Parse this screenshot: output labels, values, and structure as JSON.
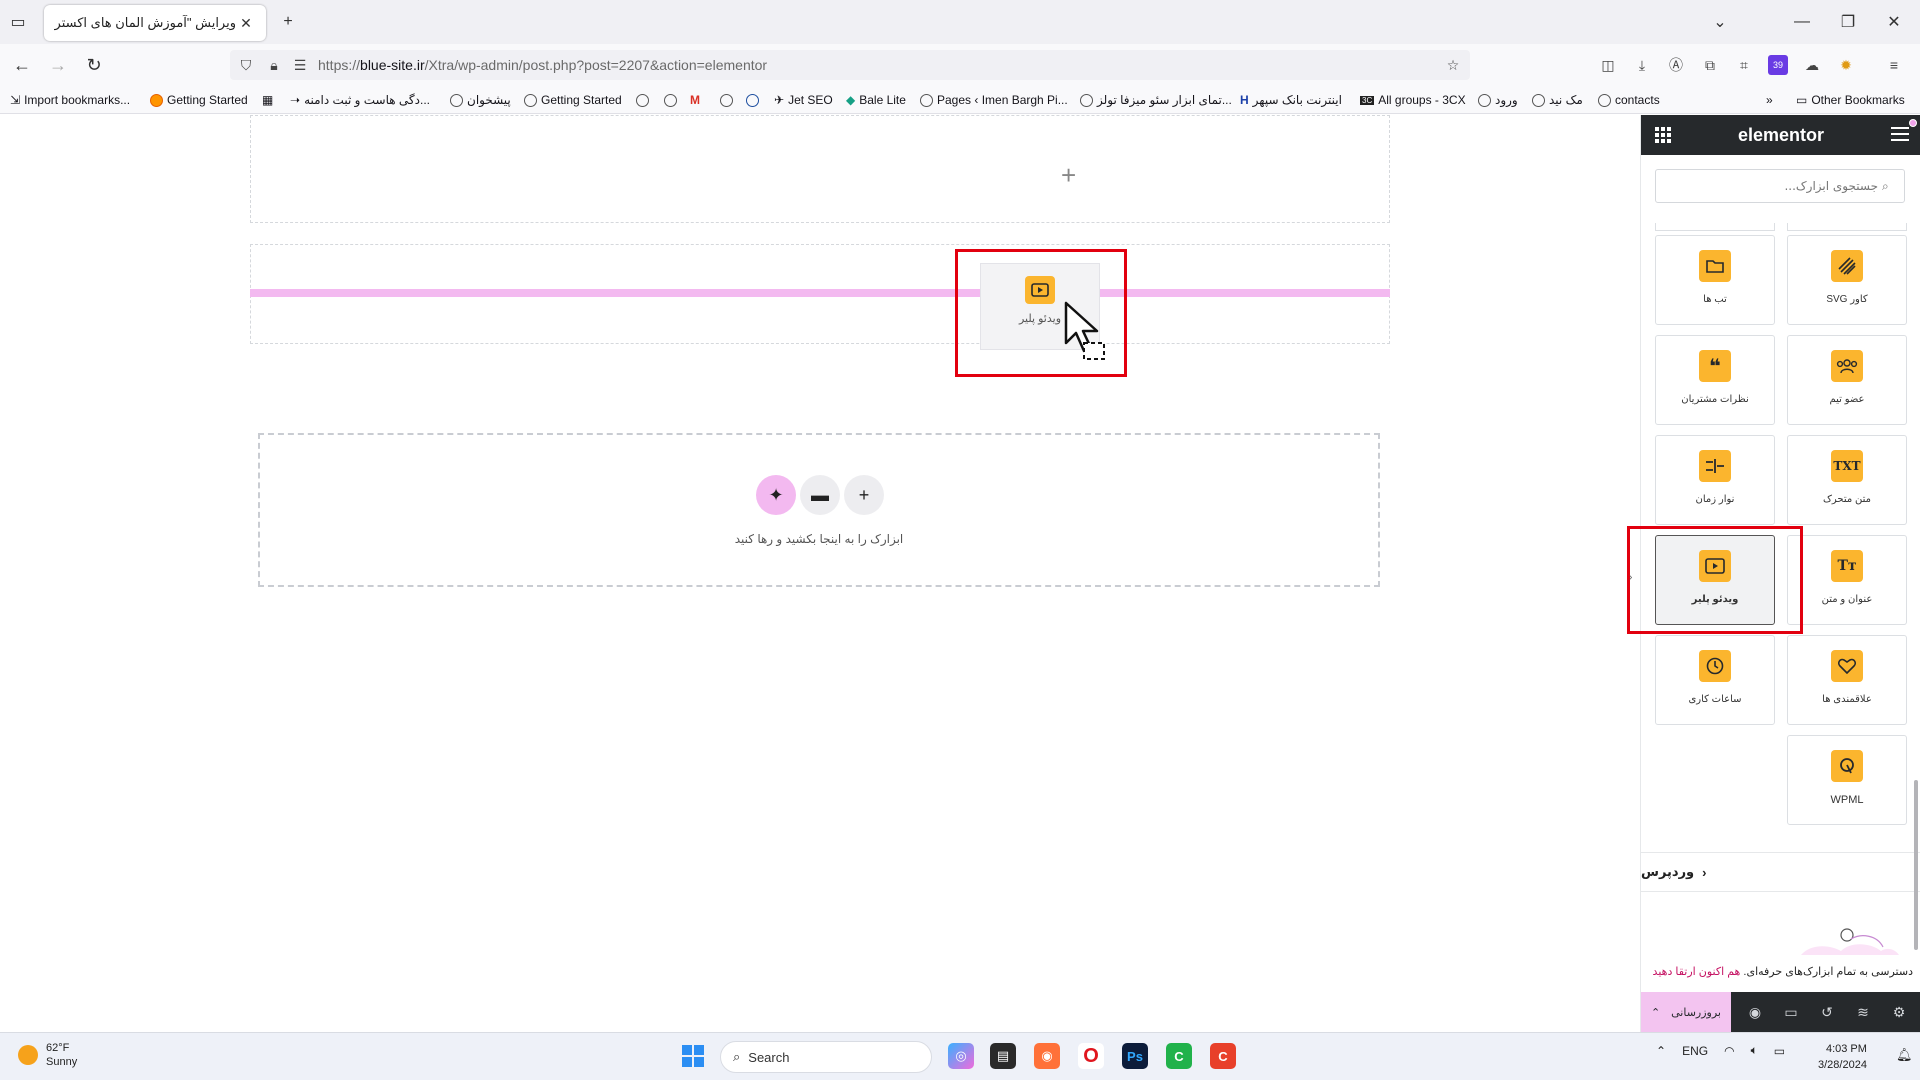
{
  "browser": {
    "tab_title": "ویرایش \"آموزش المان های اکسترا – ...",
    "url_prefix": "https://",
    "url_domain": "blue-site.ir",
    "url_path": "/Xtra/wp-admin/post.php?post=2207&action=elementor",
    "extensions_badge": "39",
    "bookmarks": [
      "Import bookmarks...",
      "Getting Started",
      "...دگی هاست و ثبت دامنه",
      "پیشخوان",
      "Getting Started",
      "Jet SEO",
      "Bale Lite",
      "Pages ‹ Imen Bargh Pi...",
      "...تمای ابزار سئو میزفا تولز",
      "اینترنت بانک سپهر",
      "All groups - 3CX",
      "ورود",
      "مک نید",
      "contacts"
    ],
    "other_bookmarks": "Other Bookmarks"
  },
  "canvas": {
    "dragging_widget_label": "ویدئو پلیر",
    "drop_hint": "ابزارک را به اینجا بکشید و رها کنید",
    "highlight_color": "#e2000f",
    "drop_line_color": "#f3b9f0"
  },
  "panel": {
    "brand": "elementor",
    "search_placeholder": "جستجوی ابزارک...",
    "widgets": [
      {
        "label": "تب ها",
        "icon": "folder-icon"
      },
      {
        "label": "کاور SVG",
        "icon": "svg-cover-icon"
      },
      {
        "label": "نظرات مشتریان",
        "icon": "quote-icon"
      },
      {
        "label": "عضو تیم",
        "icon": "team-icon"
      },
      {
        "label": "نوار زمان",
        "icon": "timeline-icon"
      },
      {
        "label": "متن متحرک",
        "icon": "animated-text-icon"
      },
      {
        "label": "ویدئو پلیر",
        "icon": "video-player-icon"
      },
      {
        "label": "عنوان و متن",
        "icon": "heading-text-icon"
      },
      {
        "label": "ساعات کاری",
        "icon": "clock-icon"
      },
      {
        "label": "علاقمندی ها",
        "icon": "heart-icon"
      },
      {
        "label": "WPML",
        "icon": "wpml-icon"
      }
    ],
    "section_wordpress": "وردپرس",
    "promo_text": "دسترسی به تمام ابزارک‌های حرفه‌ای.",
    "promo_link": "هم اکنون ارتقا دهید",
    "upgrade_label": "بروزرسانی",
    "accent_color": "#fbb52e"
  },
  "taskbar": {
    "temperature": "62°F",
    "weather": "Sunny",
    "search": "Search",
    "language": "ENG",
    "time": "4:03 PM",
    "date": "3/28/2024"
  }
}
